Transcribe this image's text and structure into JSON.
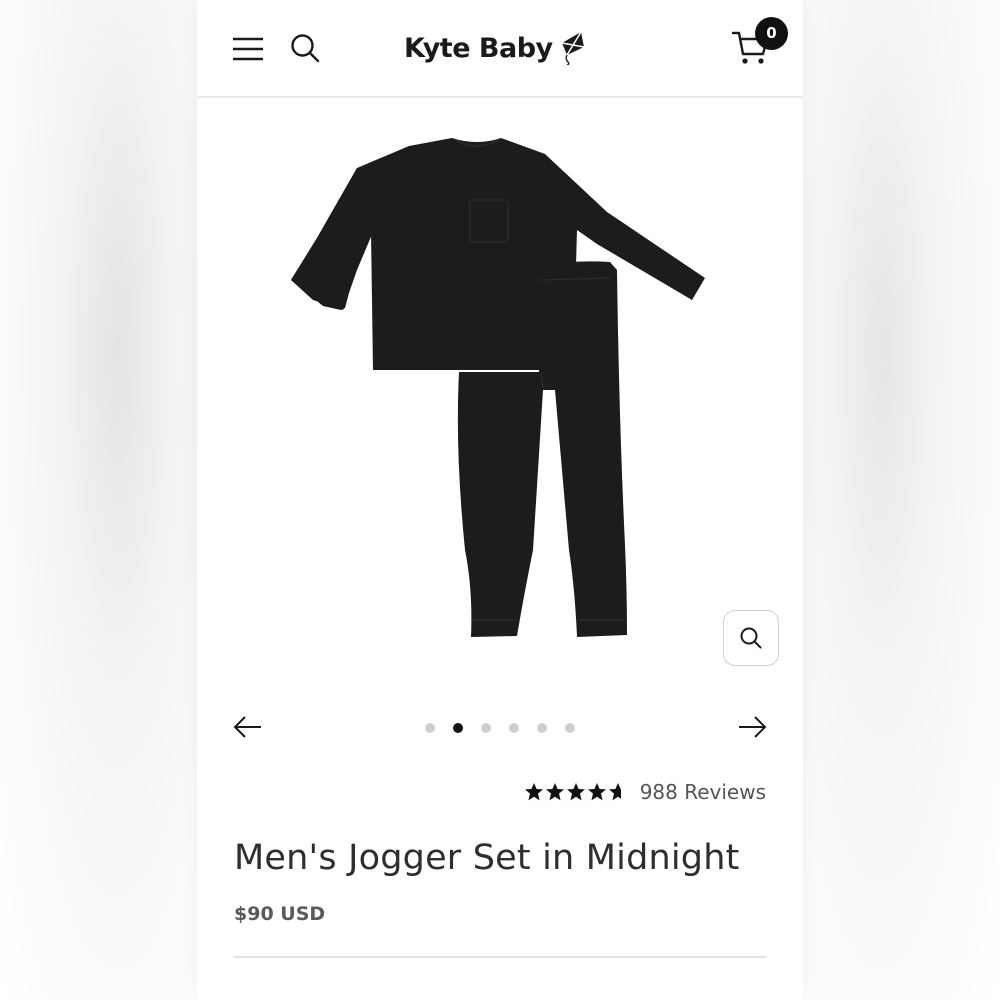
{
  "header": {
    "logo_text": "Kyte Baby",
    "cart_count": "0",
    "icons": [
      "menu-icon",
      "search-icon",
      "kite-logo-icon",
      "cart-icon"
    ]
  },
  "gallery": {
    "image_alt": "Men's Jogger Set in Midnight",
    "slide_count": 6,
    "active_slide": 2,
    "icons": [
      "zoom-icon",
      "arrow-left-icon",
      "arrow-right-icon"
    ]
  },
  "product": {
    "rating_stars": 4.5,
    "review_count": "988 Reviews",
    "title": "Men's Jogger Set in Midnight",
    "price": "$90 USD"
  },
  "colors": {
    "garment": "#1c1c1e",
    "text": "#2e2e2e",
    "badge": "#111111"
  }
}
